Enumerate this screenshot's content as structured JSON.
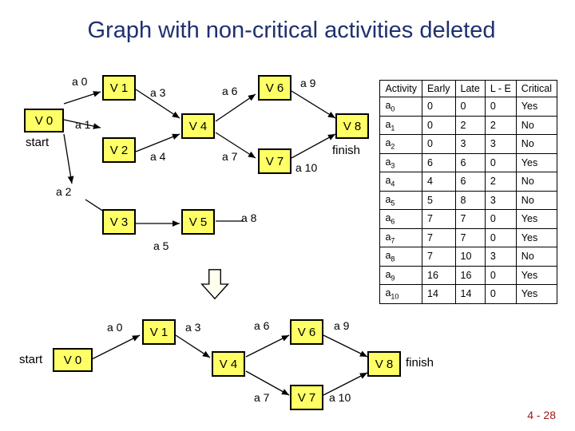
{
  "title": "Graph with non-critical activities deleted",
  "graph1": {
    "nodes": {
      "V0": "V 0",
      "start": "start",
      "V1": "V 1",
      "V2": "V 2",
      "V3": "V 3",
      "V4": "V 4",
      "V5": "V 5",
      "V6": "V 6",
      "V7": "V 7",
      "V8": "V 8",
      "finish": "finish"
    },
    "edges": {
      "a0": "a 0",
      "a1": "a 1",
      "a2": "a 2",
      "a3": "a 3",
      "a4": "a 4",
      "a5": "a 5",
      "a6": "a 6",
      "a7": "a 7",
      "a8": "a 8",
      "a9": "a 9",
      "a10": "a 10"
    }
  },
  "graph2": {
    "nodes": {
      "V0": "V 0",
      "start": "start",
      "V1": "V 1",
      "V4": "V 4",
      "V6": "V 6",
      "V7": "V 7",
      "V8": "V 8",
      "finish": "finish"
    },
    "edges": {
      "a0": "a 0",
      "a3": "a 3",
      "a6": "a 6",
      "a7": "a 7",
      "a9": "a 9",
      "a10": "a 10"
    }
  },
  "table": {
    "headers": [
      "Activity",
      "Early",
      "Late",
      "L - E",
      "Critical"
    ],
    "rows": [
      {
        "act": "a",
        "idx": "0",
        "early": "0",
        "late": "0",
        "le": "0",
        "crit": "Yes"
      },
      {
        "act": "a",
        "idx": "1",
        "early": "0",
        "late": "2",
        "le": "2",
        "crit": "No"
      },
      {
        "act": "a",
        "idx": "2",
        "early": "0",
        "late": "3",
        "le": "3",
        "crit": "No"
      },
      {
        "act": "a",
        "idx": "3",
        "early": "6",
        "late": "6",
        "le": "0",
        "crit": "Yes"
      },
      {
        "act": "a",
        "idx": "4",
        "early": "4",
        "late": "6",
        "le": "2",
        "crit": "No"
      },
      {
        "act": "a",
        "idx": "5",
        "early": "5",
        "late": "8",
        "le": "3",
        "crit": "No"
      },
      {
        "act": "a",
        "idx": "6",
        "early": "7",
        "late": "7",
        "le": "0",
        "crit": "Yes"
      },
      {
        "act": "a",
        "idx": "7",
        "early": "7",
        "late": "7",
        "le": "0",
        "crit": "Yes"
      },
      {
        "act": "a",
        "idx": "8",
        "early": "7",
        "late": "10",
        "le": "3",
        "crit": "No"
      },
      {
        "act": "a",
        "idx": "9",
        "early": "16",
        "late": "16",
        "le": "0",
        "crit": "Yes"
      },
      {
        "act": "a",
        "idx": "10",
        "early": "14",
        "late": "14",
        "le": "0",
        "crit": "Yes"
      }
    ]
  },
  "footer": "4 - 28",
  "chart_data": {
    "type": "table",
    "title": "Activity times for critical-path analysis",
    "columns": [
      "Activity",
      "Early",
      "Late",
      "L - E",
      "Critical"
    ],
    "rows": [
      [
        "a0",
        0,
        0,
        0,
        "Yes"
      ],
      [
        "a1",
        0,
        2,
        2,
        "No"
      ],
      [
        "a2",
        0,
        3,
        3,
        "No"
      ],
      [
        "a3",
        6,
        6,
        0,
        "Yes"
      ],
      [
        "a4",
        4,
        6,
        2,
        "No"
      ],
      [
        "a5",
        5,
        8,
        3,
        "No"
      ],
      [
        "a6",
        7,
        7,
        0,
        "Yes"
      ],
      [
        "a7",
        7,
        7,
        0,
        "Yes"
      ],
      [
        "a8",
        7,
        10,
        3,
        "No"
      ],
      [
        "a9",
        16,
        16,
        0,
        "Yes"
      ],
      [
        "a10",
        14,
        14,
        0,
        "Yes"
      ]
    ]
  }
}
